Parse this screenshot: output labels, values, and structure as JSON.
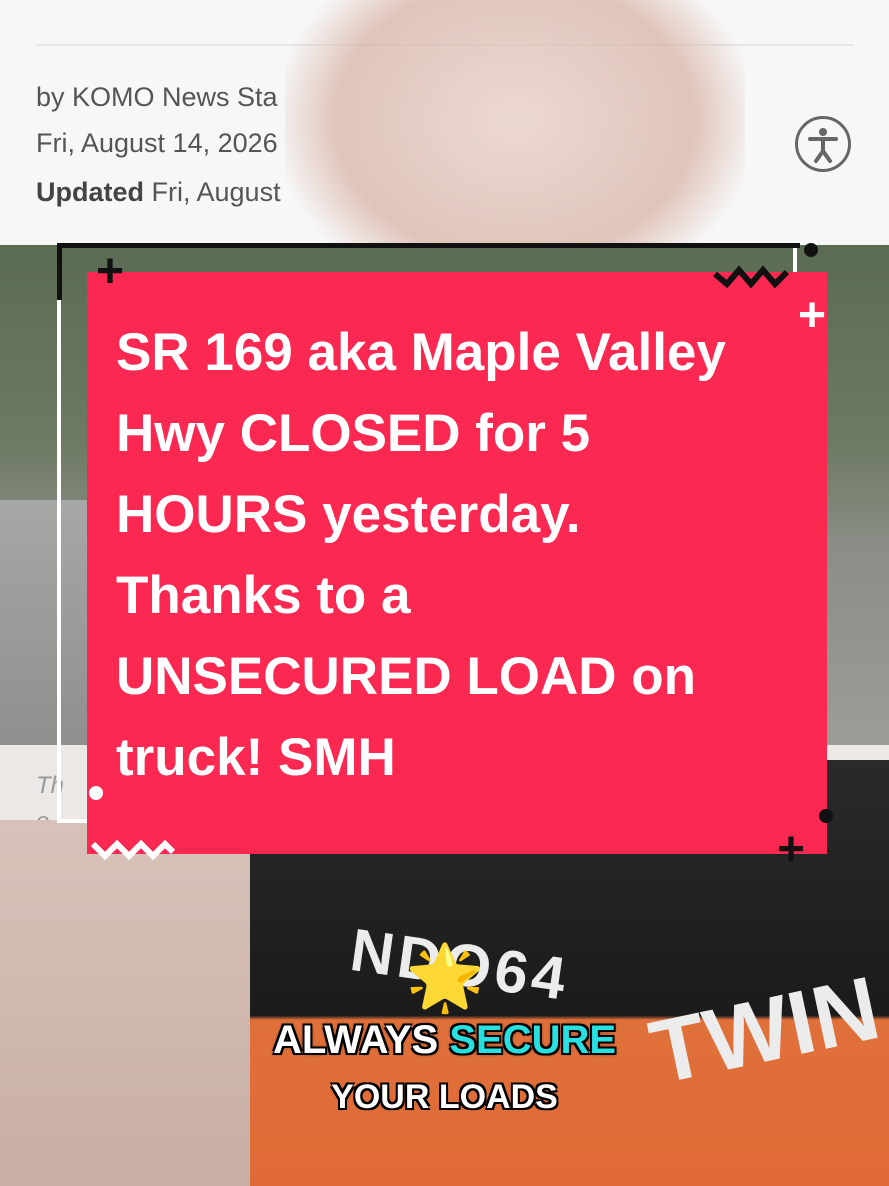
{
  "article": {
    "byline": "by KOMO News Sta",
    "date": "Fri, August 14, 2026",
    "updated_label": "Updated",
    "updated_value": "Fri, August",
    "caption_partial_1": "Th",
    "caption_partial_2": "o"
  },
  "overlay": {
    "text": "SR 169 aka Maple Valley Hwy CLOSED for 5 HOURS yesterday. Thanks to a UNSECURED LOAD on truck! SMH"
  },
  "shirt": {
    "text1": "NDO64",
    "text2": "TWIN"
  },
  "captions": {
    "line1_a": "ALWAYS",
    "line1_b": "SECURE",
    "line2": "YOUR LOADS",
    "star": "🌟"
  },
  "colors": {
    "card": "#fb2852",
    "accent": "#29e0e0"
  },
  "icons": [
    "accessibility-icon",
    "star-icon",
    "plus-icon",
    "zigzag-icon"
  ]
}
